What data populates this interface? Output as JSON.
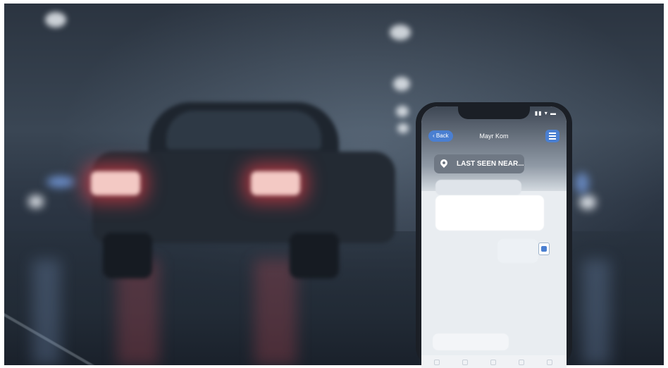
{
  "phone": {
    "status_icons": "▮▮ ▾ ▬",
    "back_label": "‹ Back",
    "chat_title": "Mayr Kom",
    "alert_text": "LAST SEEN NEAR...",
    "bubble_1": "",
    "bubble_2": "",
    "bubble_3": "",
    "bubble_4": ""
  },
  "colors": {
    "accent": "#4a7fd1",
    "tail_light": "#eb3c46",
    "alert_pill": "#6f7884"
  },
  "icons": [
    "location-pin-icon",
    "menu-icon",
    "attachment-icon",
    "back-icon"
  ]
}
